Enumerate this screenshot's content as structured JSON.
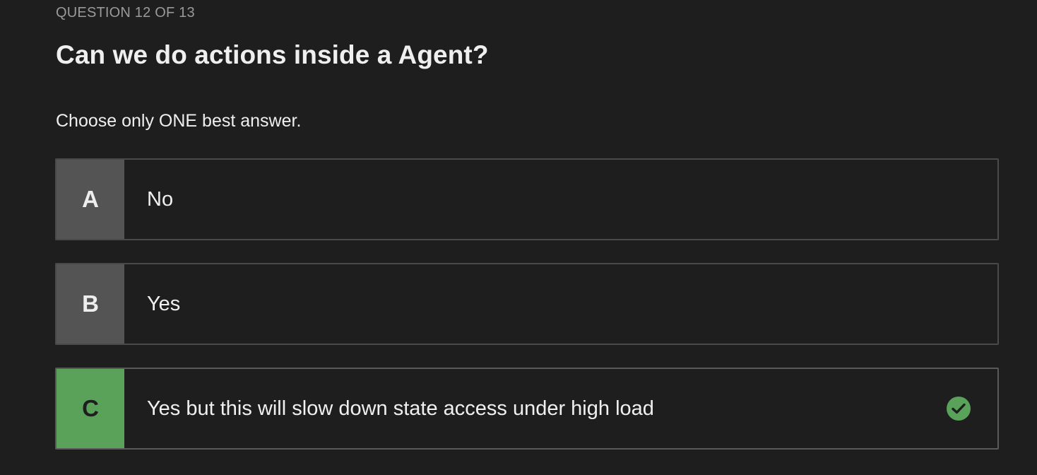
{
  "quiz": {
    "counter": "QUESTION 12 OF 13",
    "question": "Can we do actions inside a Agent?",
    "instructions": "Choose only ONE best answer.",
    "options": [
      {
        "letter": "A",
        "text": "No",
        "correct": false
      },
      {
        "letter": "B",
        "text": "Yes",
        "correct": false
      },
      {
        "letter": "C",
        "text": "Yes but this will slow down state access under high load",
        "correct": true
      }
    ],
    "correct_icon": "check-circle-icon"
  },
  "colors": {
    "background": "#1e1e1e",
    "letter_box": "#545454",
    "correct": "#5aa25a",
    "muted_text": "#9a9a9a"
  }
}
